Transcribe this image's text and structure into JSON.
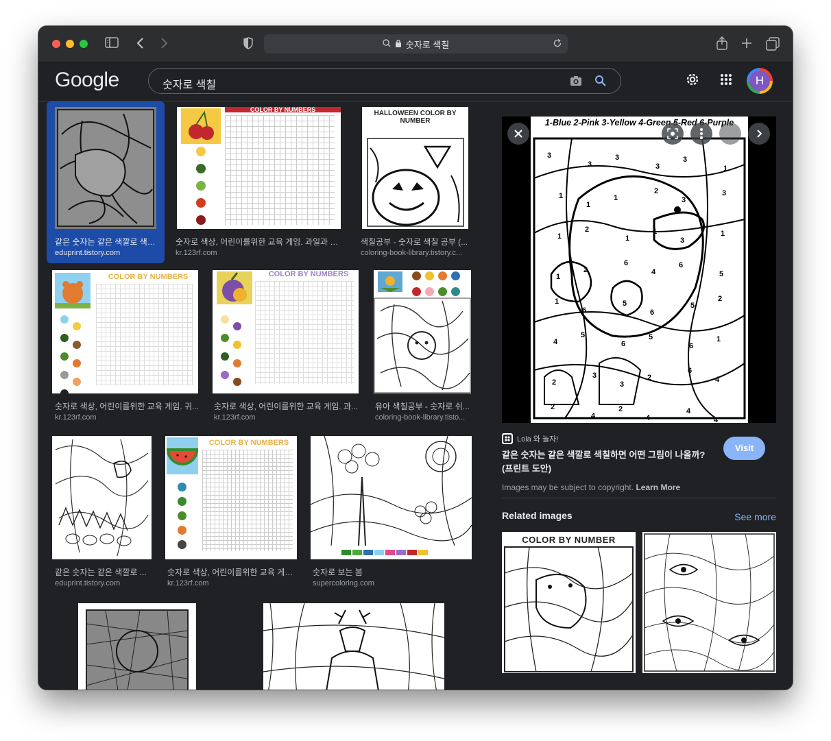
{
  "browser": {
    "address": "숫자로 색칠"
  },
  "google": {
    "logo": "Google",
    "query": "숫자로 색칠",
    "avatar_initial": "H"
  },
  "results": [
    {
      "caption": "같은 숫자는 같은 색깔로 색칠...",
      "source": "eduprint.tistory.com"
    },
    {
      "caption": "숫자로 색상, 어린이를위한 교육 게임. 과일과 채...",
      "source": "kr.123rf.com",
      "banner": "COLOR BY NUMBERS"
    },
    {
      "caption": "색칠공부 - 숫자로 색칠 공부 (...",
      "source": "coloring-book-library.tistory.c...",
      "banner": "HALLOWEEN COLOR BY NUMBER"
    },
    {
      "caption": "숫자로 색상, 어린이를위한 교육 게임. 귀...",
      "source": "kr.123rf.com",
      "banner": "COLOR BY NUMBERS"
    },
    {
      "caption": "숫자로 색상, 어린이를위한 교육 게임. 과...",
      "source": "kr.123rf.com",
      "banner": "COLOR BY NUMBERS"
    },
    {
      "caption": "유아 색칠공부 - 숫자로 쉬...",
      "source": "coloring-book-library.tisto..."
    },
    {
      "caption": "같은 숫자는 같은 색깔로 ...",
      "source": "eduprint.tistory.com"
    },
    {
      "caption": "숫자로 색상, 어린이를위한 교육 게임...",
      "source": "kr.123rf.com",
      "banner": "COLOR BY NUMBERS"
    },
    {
      "caption": "숫자로 보는 봄",
      "source": "supercoloring.com"
    }
  ],
  "preview": {
    "image_title": "1-Blue 2-Pink 3-Yellow 4-Green 5-Red 6-Purple",
    "site": "Lola 와 놀자!",
    "title": "같은 숫자는 같은 색깔로 색칠하면 어떤 그림이 나올까? (프린트 도안)",
    "visit": "Visit",
    "copyright": "Images may be subject to copyright.",
    "learn_more": "Learn More",
    "related": "Related images",
    "see_more": "See more",
    "related_title": "COLOR BY NUMBER",
    "image_numbers": [
      "3",
      "3",
      "3",
      "3",
      "3",
      "1",
      "1",
      "1",
      "1",
      "2",
      "3",
      "3",
      "1",
      "2",
      "1",
      "1",
      "3",
      "1",
      "1",
      "2",
      "6",
      "4",
      "6",
      "5",
      "1",
      "6",
      "5",
      "6",
      "5",
      "2",
      "4",
      "5",
      "6",
      "5",
      "6",
      "1",
      "2",
      "3",
      "3",
      "2",
      "6",
      "4",
      "2",
      "4",
      "2",
      "4",
      "4",
      "4"
    ]
  },
  "colors": {
    "background": "#202124",
    "accent": "#8ab4f8",
    "selected": "#1d4ba8"
  }
}
